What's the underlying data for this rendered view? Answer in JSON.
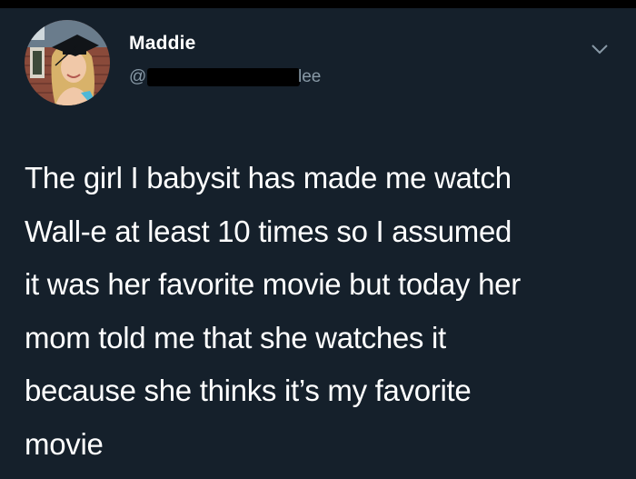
{
  "tweet": {
    "display_name": "Maddie",
    "handle_visible_prefix": "@",
    "handle_visible_suffix": "lee",
    "body": "The girl I babysit has made me watch\nWall-e at least 10 times so I assumed\nit was her favorite movie but today her\nmom told me that she watches it\nbecause she thinks it’s my favorite\nmovie"
  },
  "icons": {
    "avatar": "avatar-photo-graduation",
    "menu": "chevron-down-icon"
  },
  "colors": {
    "background": "#15202b",
    "text_primary": "#ffffff",
    "text_secondary": "#8899a6",
    "redaction": "#000000"
  }
}
